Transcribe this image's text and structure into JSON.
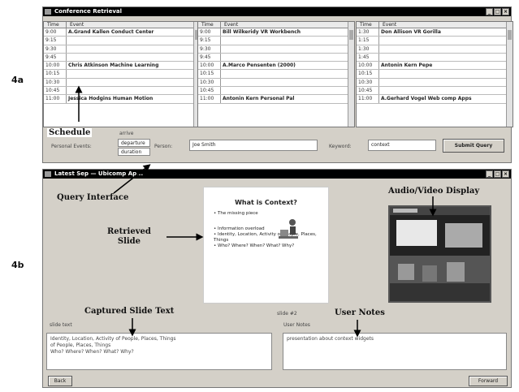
{
  "figure_labels": {
    "top": "4a",
    "bottom": "4b"
  },
  "top_window": {
    "title": "Conference Retrieval",
    "controls": [
      "_",
      "□",
      "×"
    ],
    "schedules": [
      {
        "header_time": "Time",
        "header_event": "Event",
        "rows": [
          {
            "time": "9:00",
            "event": "A.Grand Kallen Conduct Center"
          },
          {
            "time": "9:15",
            "event": ""
          },
          {
            "time": "9:30",
            "event": ""
          },
          {
            "time": "9:45",
            "event": ""
          },
          {
            "time": "10:00",
            "event": "Chris Atkinson Machine Learning"
          },
          {
            "time": "10:15",
            "event": ""
          },
          {
            "time": "10:30",
            "event": ""
          },
          {
            "time": "10:45",
            "event": ""
          },
          {
            "time": "11:00",
            "event": "Jessica Hodgins Human Motion"
          }
        ]
      },
      {
        "header_time": "Time",
        "header_event": "Event",
        "rows": [
          {
            "time": "9:00",
            "event": "Bill Wilkeridy VR Workbench"
          },
          {
            "time": "9:15",
            "event": ""
          },
          {
            "time": "9:30",
            "event": ""
          },
          {
            "time": "9:45",
            "event": ""
          },
          {
            "time": "10:00",
            "event": "A.Marco Pensenten (2000)"
          },
          {
            "time": "10:15",
            "event": ""
          },
          {
            "time": "10:30",
            "event": ""
          },
          {
            "time": "10:45",
            "event": ""
          },
          {
            "time": "11:00",
            "event": "Antonin Kern Personal Pal"
          }
        ]
      },
      {
        "header_time": "Time",
        "header_event": "Event",
        "rows": [
          {
            "time": "1:30",
            "event": "Don Allison VR Gorilla"
          },
          {
            "time": "1:15",
            "event": ""
          },
          {
            "time": "1:30",
            "event": ""
          },
          {
            "time": "1:45",
            "event": ""
          },
          {
            "time": "10:00",
            "event": "Antonin Kern Pepe"
          },
          {
            "time": "10:15",
            "event": ""
          },
          {
            "time": "10:30",
            "event": ""
          },
          {
            "time": "10:45",
            "event": ""
          },
          {
            "time": "11:00",
            "event": "A.Gerhard Vogel Web comp Apps"
          }
        ]
      }
    ],
    "query": {
      "arrive_label": "arrive",
      "personal_events_label": "Personal Events:",
      "depart_option": "departure",
      "duration_option": "duration",
      "person_label": "Person:",
      "person_value": "Joe Smith",
      "keyword_label": "Keyword:",
      "keyword_value": "context",
      "submit_label": "Submit Query"
    }
  },
  "bottom_window": {
    "title": "Latest Sep — Ubicomp Ap...",
    "controls": [
      "_",
      "□",
      "×"
    ],
    "slide": {
      "title": "What is Context?",
      "bullets": [
        "The missing piece",
        "Information overload",
        "Identity, Location, Activity of People, Places, Things",
        "Who? Where? When? What? Why?"
      ]
    },
    "slide_number": "slide #2",
    "captured_text_label": "slide text",
    "captured_text": "Identity, Location, Activity of People, Places, Things\nof People, Places, Things\nWho? Where? When? What? Why?",
    "notes_label": "User Notes",
    "notes_text": "presentation about context widgets",
    "back_label": "Back",
    "forward_label": "Forward"
  },
  "annotations": {
    "schedule": "Schedule",
    "query_interface": "Query Interface",
    "retrieved_slide": "Retrieved\nSlide",
    "av_display": "Audio/Video Display",
    "captured_slide_text": "Captured Slide Text",
    "user_notes": "User Notes"
  }
}
